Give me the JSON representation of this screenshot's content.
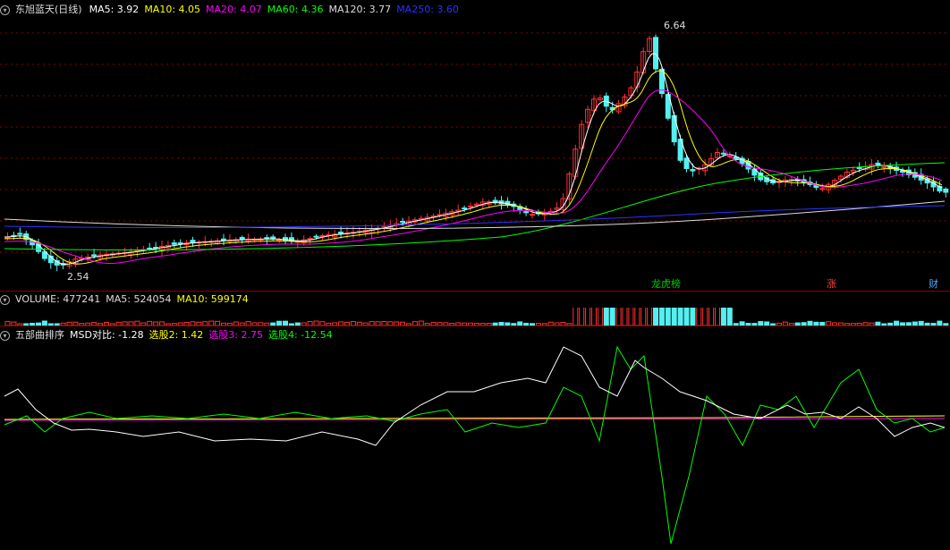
{
  "main": {
    "title": "东旭蓝天(日线)",
    "ma": [
      {
        "label": "MA5: 3.92",
        "color": "#ffffff"
      },
      {
        "label": "MA10: 4.05",
        "color": "#ffff00"
      },
      {
        "label": "MA20: 4.07",
        "color": "#ff00ff"
      },
      {
        "label": "MA60: 4.36",
        "color": "#00ff00"
      },
      {
        "label": "MA120: 3.77",
        "color": "#dddddd"
      },
      {
        "label": "MA250: 3.60",
        "color": "#3030ff"
      }
    ],
    "high_label": "6.64",
    "low_label": "2.54",
    "tags": [
      {
        "text": "龙虎榜",
        "color": "#00cc00"
      },
      {
        "text": "涨",
        "color": "#ff4040"
      },
      {
        "text": "财",
        "color": "#4fa3ff"
      }
    ]
  },
  "volume": {
    "title": "VOLUME: 477241",
    "ma5": "MA5: 524054",
    "ma10": "MA10: 599174"
  },
  "indicator": {
    "title": "五部曲排序",
    "items": [
      {
        "label": "MSD对比: -1.28",
        "color": "#ffffff"
      },
      {
        "label": "选股2: 1.42",
        "color": "#ffff00"
      },
      {
        "label": "选股3: 2.75",
        "color": "#ff00ff"
      },
      {
        "label": "选股4: -12.54",
        "color": "#00ff00"
      }
    ]
  },
  "colors": {
    "up": "#ff3030",
    "down": "#54f0f0",
    "grid": "#8b0000"
  }
}
